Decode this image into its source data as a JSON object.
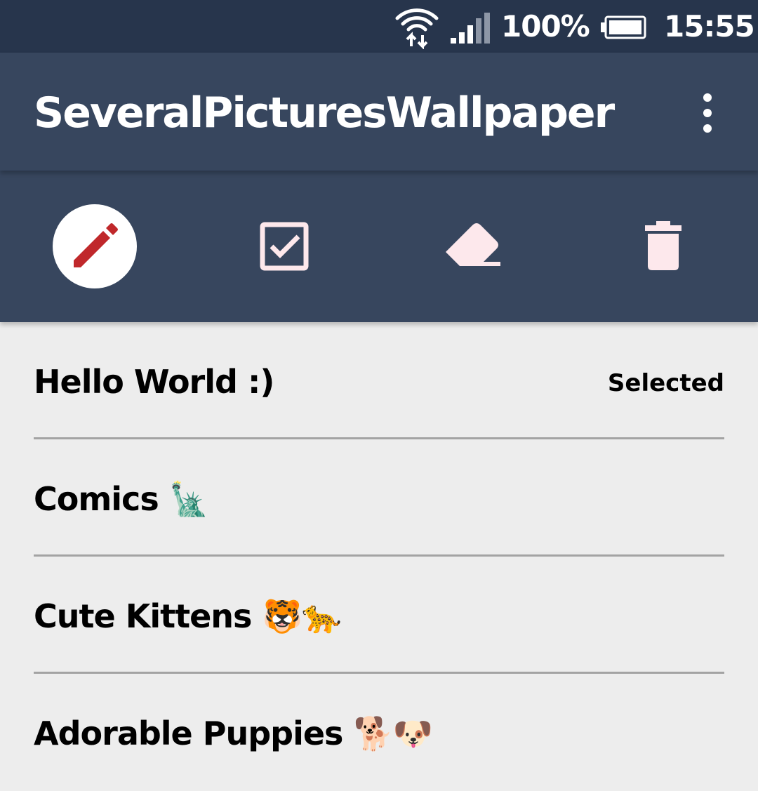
{
  "status_bar": {
    "battery_percent": "100%",
    "time": "15:55",
    "icons": [
      "wifi-icon",
      "signal-icon",
      "battery-icon"
    ]
  },
  "app_bar": {
    "title": "SeveralPicturesWallpaper",
    "menu_icon": "more-vert-icon"
  },
  "toolbar": {
    "tools": [
      {
        "icon": "pencil-icon",
        "active": true
      },
      {
        "icon": "checkbox-icon",
        "active": false
      },
      {
        "icon": "eraser-icon",
        "active": false
      },
      {
        "icon": "trash-icon",
        "active": false
      }
    ]
  },
  "colors": {
    "status_bar": "#27354c",
    "app_bar": "#37465e",
    "background": "#ededed",
    "accent_red": "#c0282b",
    "icon_tint": "#fde8ec"
  },
  "list": {
    "items": [
      {
        "title": "Hello World :)",
        "status": "Selected"
      },
      {
        "title": "Comics 🗽",
        "status": ""
      },
      {
        "title": "Cute Kittens 🐯🐆",
        "status": ""
      },
      {
        "title": "Adorable Puppies 🐕🐶",
        "status": ""
      }
    ]
  }
}
